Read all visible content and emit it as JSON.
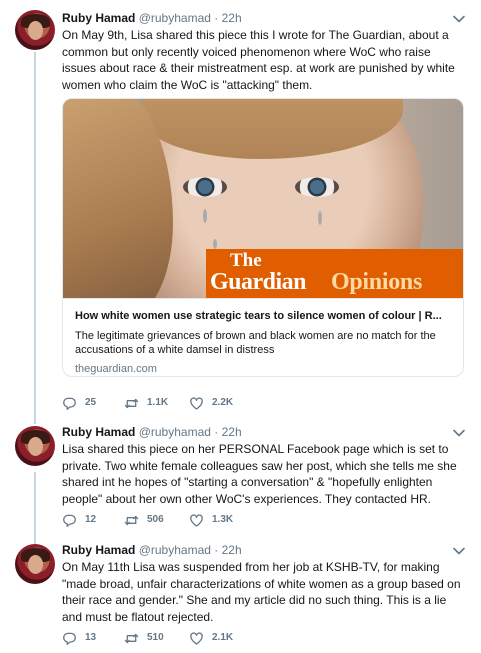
{
  "tweets": [
    {
      "name": "Ruby Hamad",
      "handle": "@rubyhamad",
      "separator": "·",
      "time": "22h",
      "text": "On May 9th, Lisa shared this piece this I wrote for The Guardian, about a common but only recently voiced phenomenon where WoC who raise issues about race & their mistreatment esp. at work are punished by white women who claim the WoC is \"attacking\" them.",
      "card": {
        "badge_the": "The",
        "badge_guardian": "Guardian",
        "badge_opinions": "Opinions",
        "title": "How white women use strategic tears to silence women of colour | R...",
        "description": "The legitimate grievances of brown and black women are no match for the accusations of a white damsel in distress",
        "domain": "theguardian.com"
      },
      "replies": "25",
      "retweets": "1.1K",
      "likes": "2.2K"
    },
    {
      "name": "Ruby Hamad",
      "handle": "@rubyhamad",
      "separator": "·",
      "time": "22h",
      "text": "Lisa shared this piece on her PERSONAL Facebook page which is set to private. Two white female colleagues saw her post, which she tells me she shared int he hopes of \"starting a conversation\" & \"hopefully enlighten people\" about her own other WoC's experiences. They contacted HR.",
      "replies": "12",
      "retweets": "506",
      "likes": "1.3K"
    },
    {
      "name": "Ruby Hamad",
      "handle": "@rubyhamad",
      "separator": "·",
      "time": "22h",
      "text": "On May 11th Lisa was suspended from her job at KSHB-TV, for making \"made broad, unfair characterizations of white women as a group based on their race and gender.\" She and my article did no such thing. This is a lie and must be flatout rejected.",
      "replies": "13",
      "retweets": "510",
      "likes": "2.1K"
    }
  ],
  "icons": {
    "reply": "reply-icon",
    "retweet": "retweet-icon",
    "like": "heart-icon",
    "caret": "chevron-down-icon"
  },
  "colors": {
    "text": "#14171a",
    "secondary": "#657786",
    "border": "#e1e8ed",
    "thread_line": "#ccd6dd",
    "guardian_orange": "#e05e00"
  }
}
